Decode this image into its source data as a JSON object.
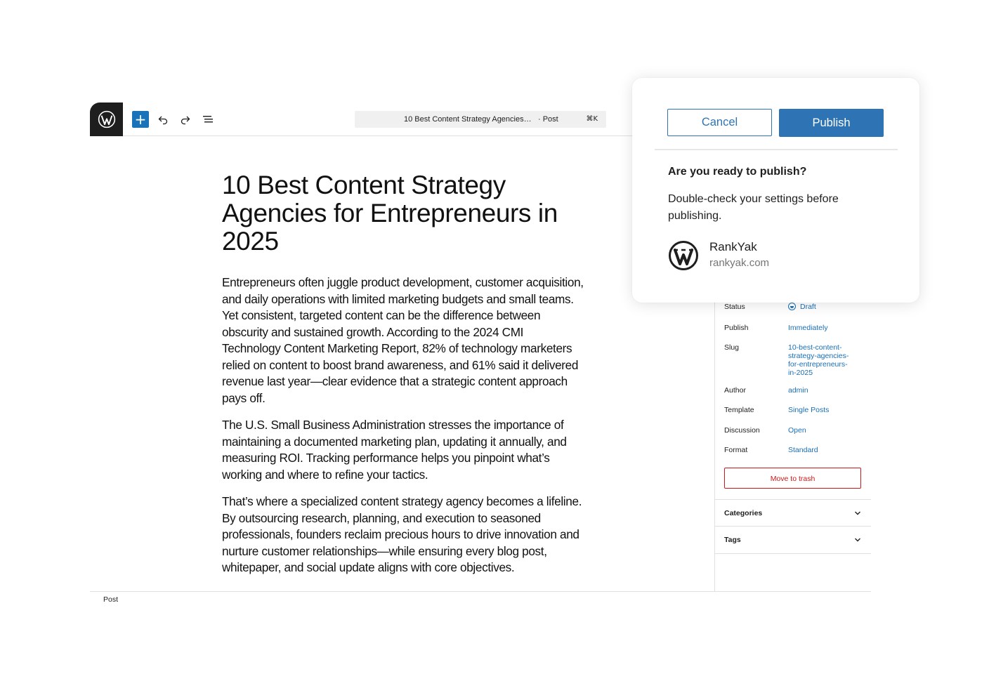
{
  "topbar": {
    "command_title": "10 Best Content Strategy Agencies for Entrepreneurs in 2025",
    "command_type": "· Post",
    "command_shortcut": "⌘K",
    "inserter_label": "+"
  },
  "post": {
    "title": "10 Best Content Strategy Agencies for Entrepreneurs in 2025",
    "paragraphs": [
      "Entrepreneurs often juggle product development, customer acquisition, and daily operations with limited marketing budgets and small teams. Yet consistent, targeted content can be the difference between obscurity and sustained growth. According to the 2024 CMI Technology Content Marketing Report, 82% of technology marketers relied on content to boost brand awareness, and 61% said it delivered revenue last year—clear evidence that a strategic content approach pays off.",
      "The U.S. Small Business Administration stresses the importance of maintaining a documented marketing plan, updating it annually, and measuring ROI. Tracking performance helps you pinpoint what’s working and where to refine your tactics.",
      "That’s where a specialized content strategy agency becomes a lifeline. By outsourcing research, planning, and execution to seasoned professionals, founders reclaim precious hours to drive innovation and nurture customer relationships—while ensuring every blog post, whitepaper, and social update aligns with core objectives."
    ]
  },
  "sidebar": {
    "rows": [
      {
        "label": "Status",
        "value": "Draft"
      },
      {
        "label": "Publish",
        "value": "Immediately"
      },
      {
        "label": "Slug",
        "value": "10-best-content-strategy-agencies-for-entrepreneurs-in-2025"
      },
      {
        "label": "Author",
        "value": "admin"
      },
      {
        "label": "Template",
        "value": "Single Posts"
      },
      {
        "label": "Discussion",
        "value": "Open"
      },
      {
        "label": "Format",
        "value": "Standard"
      }
    ],
    "trash_label": "Move to trash",
    "panels": [
      "Categories",
      "Tags"
    ]
  },
  "footer": {
    "breadcrumb": "Post"
  },
  "publish_panel": {
    "cancel_label": "Cancel",
    "publish_label": "Publish",
    "heading": "Are you ready to publish?",
    "description": "Double-check your settings before publishing.",
    "site_name": "RankYak",
    "site_url": "rankyak.com"
  },
  "colors": {
    "accent": "#2e74b5",
    "link": "#1a6fb6",
    "danger": "#cc1818",
    "logo_bg": "#1e1e1e"
  },
  "icons": [
    "wordpress-icon",
    "plus-icon",
    "undo-icon",
    "redo-icon",
    "document-overview-icon",
    "draft-status-icon",
    "chevron-down-icon"
  ]
}
